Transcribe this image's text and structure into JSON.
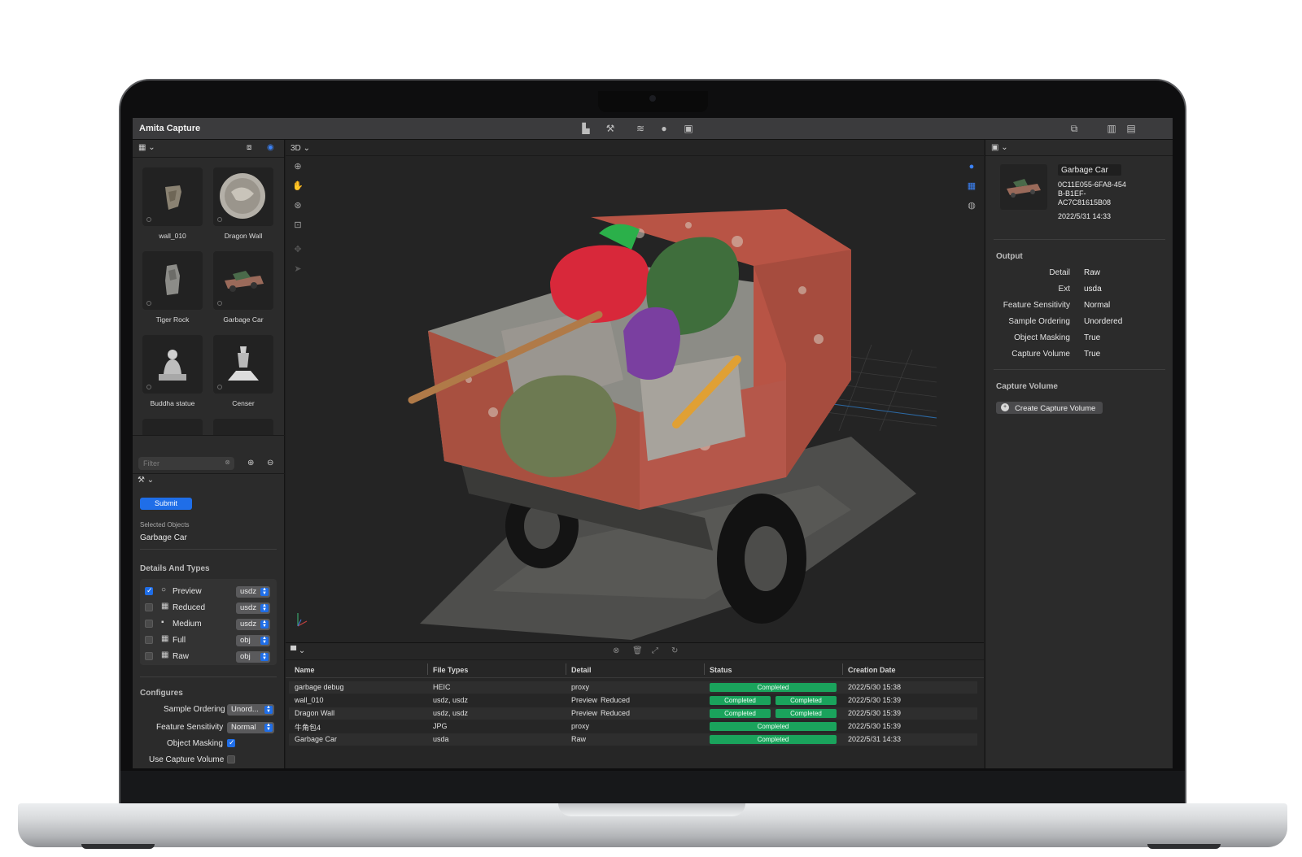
{
  "app": {
    "title": "Amita Capture"
  },
  "left_panel": {
    "objects": [
      {
        "label": "wall_010"
      },
      {
        "label": "Dragon Wall"
      },
      {
        "label": "Tiger Rock"
      },
      {
        "label": "Garbage Car"
      },
      {
        "label": "Buddha statue"
      },
      {
        "label": "Censer"
      }
    ],
    "filter_placeholder": "Filter",
    "submit_label": "Submit",
    "selected_objects_label": "Selected Objects",
    "selected_object": "Garbage Car",
    "details_heading": "Details And Types",
    "details": [
      {
        "label": "Preview",
        "checked": true,
        "format": "usdz"
      },
      {
        "label": "Reduced",
        "checked": false,
        "format": "usdz"
      },
      {
        "label": "Medium",
        "checked": false,
        "format": "usdz"
      },
      {
        "label": "Full",
        "checked": false,
        "format": "obj"
      },
      {
        "label": "Raw",
        "checked": false,
        "format": "obj"
      }
    ],
    "configures_heading": "Configures",
    "configures": {
      "sample_ordering_label": "Sample Ordering",
      "sample_ordering_value": "Unord...",
      "feature_sensitivity_label": "Feature Sensitivity",
      "feature_sensitivity_value": "Normal",
      "object_masking_label": "Object Masking",
      "object_masking_checked": true,
      "use_capture_volume_label": "Use Capture Volume",
      "use_capture_volume_checked": false
    }
  },
  "viewport": {
    "view_mode": "3D"
  },
  "table": {
    "columns": [
      "Name",
      "File Types",
      "Detail",
      "Status",
      "Creation Date"
    ],
    "rows": [
      {
        "name": "garbage debug",
        "types": "HEIC",
        "detail": [
          "proxy"
        ],
        "status": [
          "Completed"
        ],
        "date": "2022/5/30 15:38"
      },
      {
        "name": "wall_010",
        "types": "usdz, usdz",
        "detail": [
          "Preview",
          "Reduced"
        ],
        "status": [
          "Completed",
          "Completed"
        ],
        "date": "2022/5/30 15:39"
      },
      {
        "name": "Dragon Wall",
        "types": "usdz, usdz",
        "detail": [
          "Preview",
          "Reduced"
        ],
        "status": [
          "Completed",
          "Completed"
        ],
        "date": "2022/5/30 15:39"
      },
      {
        "name": "牛角包4",
        "types": "JPG",
        "detail": [
          "proxy"
        ],
        "status": [
          "Completed"
        ],
        "date": "2022/5/30 15:39"
      },
      {
        "name": "Garbage Car",
        "types": "usda",
        "detail": [
          "Raw"
        ],
        "status": [
          "Completed"
        ],
        "date": "2022/5/31 14:33"
      }
    ]
  },
  "inspector": {
    "name": "Garbage Car",
    "id_lines": [
      "0C11E055-6FA8-454",
      "B-B1EF-",
      "AC7C81615B08"
    ],
    "date": "2022/5/31 14:33",
    "output_heading": "Output",
    "output": [
      {
        "key": "Detail",
        "value": "Raw"
      },
      {
        "key": "Ext",
        "value": "usda"
      },
      {
        "key": "Feature Sensitivity",
        "value": "Normal"
      },
      {
        "key": "Sample Ordering",
        "value": "Unordered"
      },
      {
        "key": "Object Masking",
        "value": "True"
      },
      {
        "key": "Capture Volume",
        "value": "True"
      }
    ],
    "capture_volume_heading": "Capture Volume",
    "create_capture_volume_label": "Create Capture Volume"
  },
  "colors": {
    "accent": "#1f6ee8",
    "status_green": "#1aa35c",
    "panel": "#2b2b2b",
    "viewport": "#242424"
  }
}
